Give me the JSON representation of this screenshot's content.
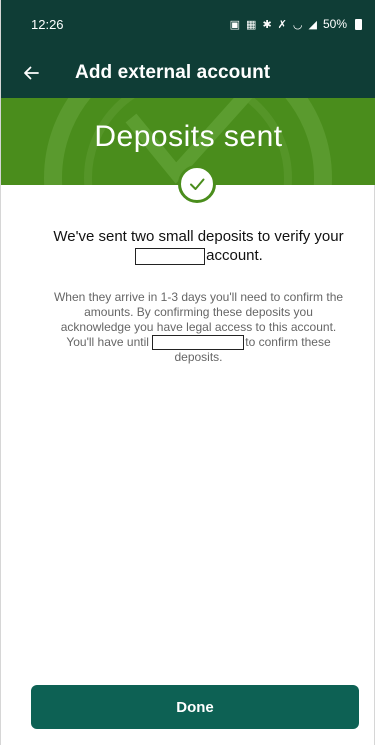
{
  "status_bar": {
    "time": "12:26",
    "icons": [
      "nfc-icon",
      "notification-icon",
      "bluetooth-icon",
      "mute-icon",
      "wifi-icon",
      "signal-icon"
    ],
    "battery": "50%"
  },
  "app_bar": {
    "title": "Add external account"
  },
  "hero": {
    "title": "Deposits sent"
  },
  "content": {
    "headline_part1": "We've sent two small deposits to verify your",
    "headline_part2": "account.",
    "body_part1": "When they arrive in 1-3 days you'll need to confirm the amounts. By confirming these deposits you acknowledge you have legal access to this account. You'll have until",
    "body_part2": "to confirm these deposits."
  },
  "actions": {
    "done_label": "Done"
  },
  "colors": {
    "header_bg": "#0f3d36",
    "hero_bg": "#4a8d1c",
    "button_bg": "#0d6154"
  }
}
